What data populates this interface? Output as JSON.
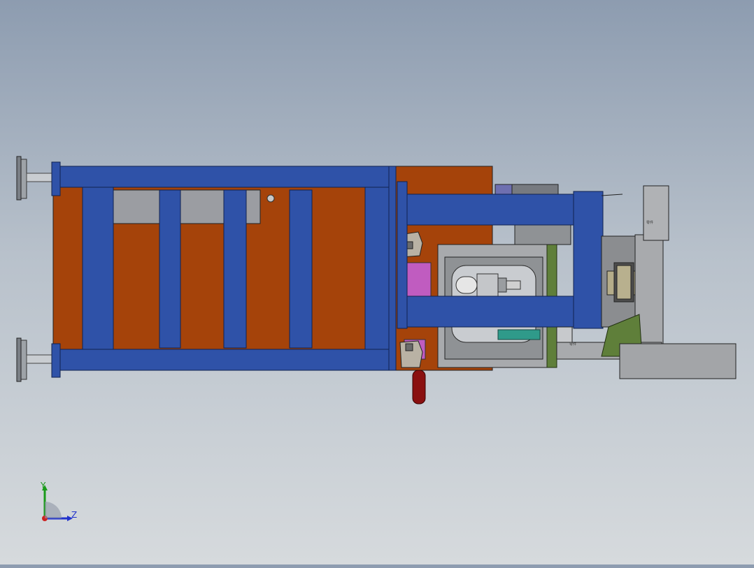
{
  "viewport": {
    "background_top": "#8d9cb0",
    "background_bottom": "#d6dadd"
  },
  "colors": {
    "frame_blue": "#2f52a8",
    "plate_orange": "#a5430a",
    "steel_grey": "#a8aaad",
    "magenta_block": "#c05cc0",
    "green_plate": "#5f7f3a",
    "red_handle": "#8a1010"
  },
  "triad": {
    "y_label": "Y",
    "z_label": "Z"
  },
  "part_labels": {
    "label_a": "零件",
    "label_b": "零件"
  }
}
